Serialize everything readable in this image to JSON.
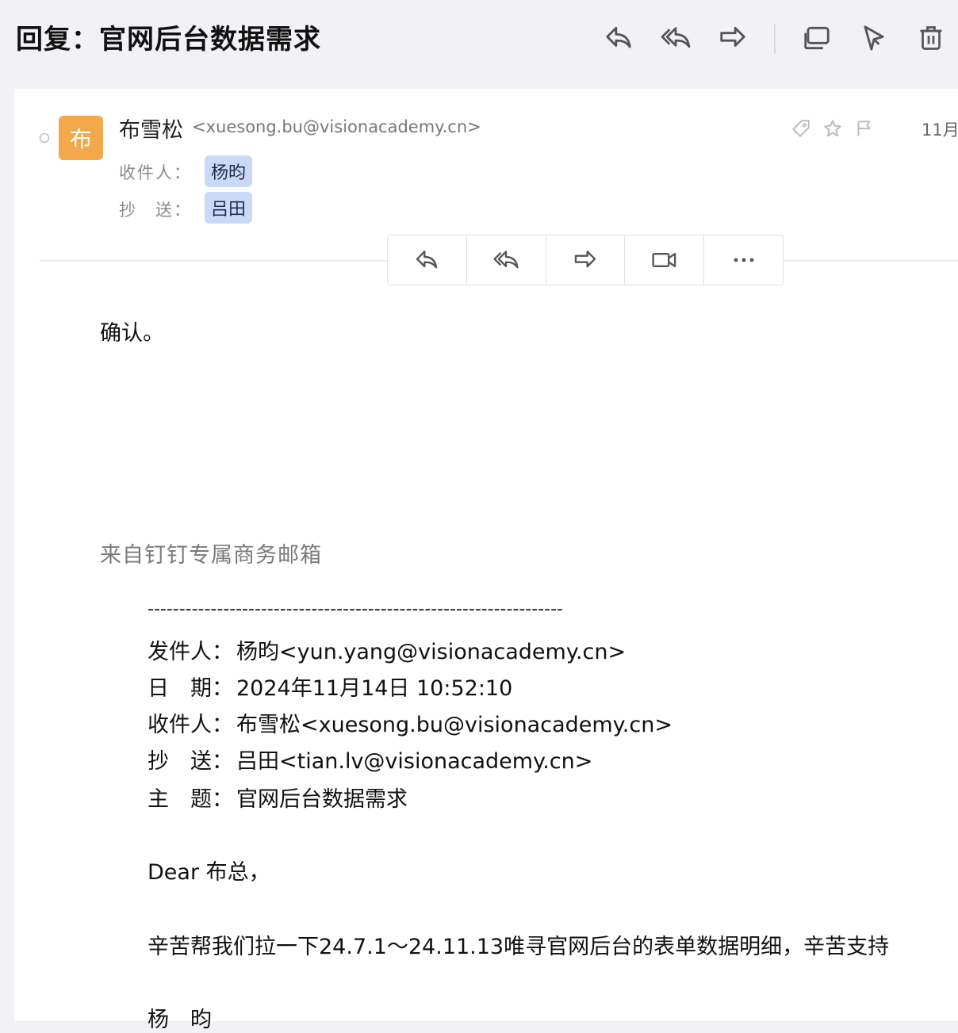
{
  "title": "回复：官网后台数据需求",
  "toolbar": {
    "icons": [
      "reply-icon",
      "reply-all-icon",
      "forward-icon",
      "new-window-icon",
      "pin-icon",
      "trash-icon"
    ]
  },
  "sender": {
    "avatar_char": "布",
    "name": "布雪松",
    "email": "<xuesong.bu@visionacademy.cn>"
  },
  "recipients": {
    "to_label": "收件人：",
    "to": "杨昀",
    "cc_label": "抄　送：",
    "cc": "吕田"
  },
  "date_partial": "11月",
  "header_icons": [
    "tag-icon",
    "star-icon",
    "flag-icon"
  ],
  "action_bar": [
    "reply-icon",
    "reply-all-icon",
    "forward-icon",
    "video-icon",
    "more-icon"
  ],
  "body": {
    "text": "确认。",
    "signature": "来自钉钉专属商务邮箱"
  },
  "quoted": {
    "divider": "------------------------------------------------------------------",
    "from_label": "发件人：",
    "from": "杨昀<yun.yang@visionacademy.cn>",
    "date_label": "日　期：",
    "date": "2024年11月14日 10:52:10",
    "to_label": "收件人：",
    "to": "布雪松<xuesong.bu@visionacademy.cn>",
    "cc_label": "抄　送：",
    "cc": "吕田<tian.lv@visionacademy.cn>",
    "subject_label": "主　题：",
    "subject": "官网后台数据需求",
    "greeting": "Dear 布总，",
    "content": "辛苦帮我们拉一下24.7.1～24.11.13唯寻官网后台的表单数据明细，辛苦支持",
    "sign": "杨　昀"
  },
  "colors": {
    "background": "#f1f1f6",
    "avatar": "#f3a94a",
    "chip": "#c9d9f7"
  }
}
